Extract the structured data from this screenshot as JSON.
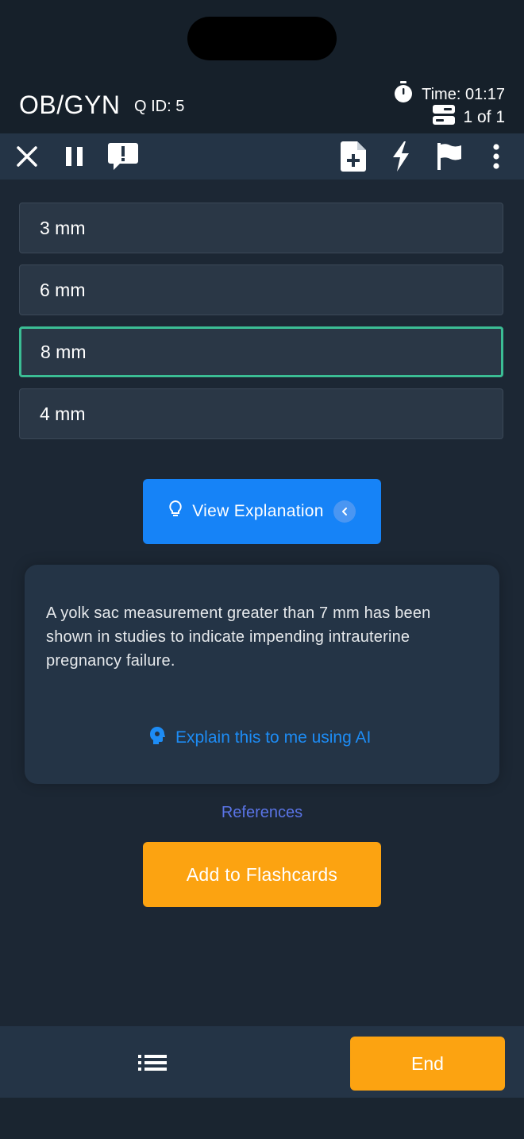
{
  "header": {
    "title": "OB/GYN",
    "qid": "Q ID: 5",
    "timer": "Time: 01:17",
    "count": "1 of 1"
  },
  "toolbar": {
    "left_icons": [
      "close-icon",
      "pause-icon",
      "report-icon"
    ],
    "right_icons": [
      "add-note-icon",
      "lightning-icon",
      "flag-icon",
      "more-vertical-icon"
    ]
  },
  "answers": [
    {
      "label": "3 mm",
      "selected": false
    },
    {
      "label": "6 mm",
      "selected": false
    },
    {
      "label": "8 mm",
      "selected": true
    },
    {
      "label": "4 mm",
      "selected": false
    }
  ],
  "view_explanation": {
    "label": "View Explanation",
    "icon": "lightbulb-icon"
  },
  "explanation": {
    "text": "A yolk sac measurement greater than 7 mm has been shown in studies to indicate impending intrauterine pregnancy failure.",
    "ai_link": "Explain this to me using AI",
    "ai_icon": "ai-brain-icon"
  },
  "references": "References",
  "flashcards_button": "Add to Flashcards",
  "bottom": {
    "end_label": "End",
    "list_icon": "list-icon"
  },
  "colors": {
    "background": "#1c2734",
    "toolbar": "#243446",
    "accent_blue": "#1683f7",
    "accent_orange": "#fca311",
    "selected_border": "#3bbd94",
    "link_blue": "#1d8cf5",
    "references": "#5a74e6"
  }
}
